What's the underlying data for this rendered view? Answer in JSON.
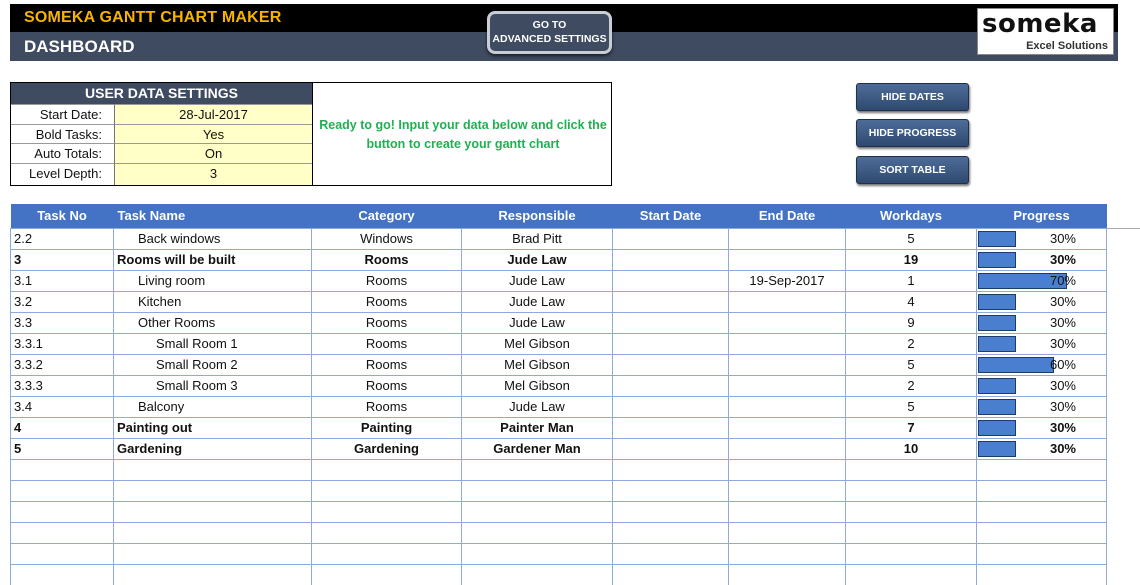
{
  "header": {
    "app_title": "SOMEKA GANTT CHART MAKER",
    "page_title": "DASHBOARD",
    "advanced_button": [
      "GO TO",
      "ADVANCED SETTINGS"
    ],
    "logo_main": "someka",
    "logo_sub": "Excel Solutions"
  },
  "settings": {
    "heading": "USER DATA SETTINGS",
    "rows": [
      {
        "label": "Start Date:",
        "value": "28-Jul-2017"
      },
      {
        "label": "Bold Tasks:",
        "value": "Yes"
      },
      {
        "label": "Auto Totals:",
        "value": "On"
      },
      {
        "label": "Level Depth:",
        "value": "3"
      }
    ],
    "message": "Ready to go! Input your data below and click the button to create your gantt chart"
  },
  "buttons": {
    "hide_dates": "HIDE DATES",
    "hide_progress": "HIDE PROGRESS",
    "sort_table": "SORT TABLE"
  },
  "table": {
    "columns": [
      "Task No",
      "Task Name",
      "Category",
      "Responsible",
      "Start Date",
      "End Date",
      "Workdays",
      "Progress"
    ],
    "rows": [
      {
        "no": "2.2",
        "name": "Back windows",
        "indent": 1,
        "category": "Windows",
        "responsible": "Brad Pitt",
        "start": "",
        "end": "",
        "workdays": "5",
        "progress": "30%",
        "progress_value": 0.3,
        "bold": false
      },
      {
        "no": "3",
        "name": "Rooms will be built",
        "indent": 0,
        "category": "Rooms",
        "responsible": "Jude Law",
        "start": "",
        "end": "",
        "workdays": "19",
        "progress": "30%",
        "progress_value": 0.3,
        "bold": true
      },
      {
        "no": "3.1",
        "name": "Living room",
        "indent": 1,
        "category": "Rooms",
        "responsible": "Jude Law",
        "start": "",
        "end": "19-Sep-2017",
        "workdays": "1",
        "progress": "70%",
        "progress_value": 0.7,
        "bold": false
      },
      {
        "no": "3.2",
        "name": "Kitchen",
        "indent": 1,
        "category": "Rooms",
        "responsible": "Jude Law",
        "start": "",
        "end": "",
        "workdays": "4",
        "progress": "30%",
        "progress_value": 0.3,
        "bold": false
      },
      {
        "no": "3.3",
        "name": "Other Rooms",
        "indent": 1,
        "category": "Rooms",
        "responsible": "Jude Law",
        "start": "",
        "end": "",
        "workdays": "9",
        "progress": "30%",
        "progress_value": 0.3,
        "bold": false
      },
      {
        "no": "3.3.1",
        "name": "Small Room 1",
        "indent": 2,
        "category": "Rooms",
        "responsible": "Mel Gibson",
        "start": "",
        "end": "",
        "workdays": "2",
        "progress": "30%",
        "progress_value": 0.3,
        "bold": false
      },
      {
        "no": "3.3.2",
        "name": "Small Room 2",
        "indent": 2,
        "category": "Rooms",
        "responsible": "Mel Gibson",
        "start": "",
        "end": "",
        "workdays": "5",
        "progress": "60%",
        "progress_value": 0.6,
        "bold": false
      },
      {
        "no": "3.3.3",
        "name": "Small Room 3",
        "indent": 2,
        "category": "Rooms",
        "responsible": "Mel Gibson",
        "start": "",
        "end": "",
        "workdays": "2",
        "progress": "30%",
        "progress_value": 0.3,
        "bold": false
      },
      {
        "no": "3.4",
        "name": "Balcony",
        "indent": 1,
        "category": "Rooms",
        "responsible": "Jude Law",
        "start": "",
        "end": "",
        "workdays": "5",
        "progress": "30%",
        "progress_value": 0.3,
        "bold": false
      },
      {
        "no": "4",
        "name": "Painting out",
        "indent": 0,
        "category": "Painting",
        "responsible": "Painter Man",
        "start": "",
        "end": "",
        "workdays": "7",
        "progress": "30%",
        "progress_value": 0.3,
        "bold": true
      },
      {
        "no": "5",
        "name": "Gardening",
        "indent": 0,
        "category": "Gardening",
        "responsible": "Gardener Man",
        "start": "",
        "end": "",
        "workdays": "10",
        "progress": "30%",
        "progress_value": 0.3,
        "bold": true
      }
    ]
  },
  "colors": {
    "header_dark": "#3e4b60",
    "title_accent": "#f5b400",
    "table_header": "#4472c4",
    "progress_fill": "#4a7ecf",
    "input_cell": "#ffffc7",
    "message_green": "#20b050"
  }
}
